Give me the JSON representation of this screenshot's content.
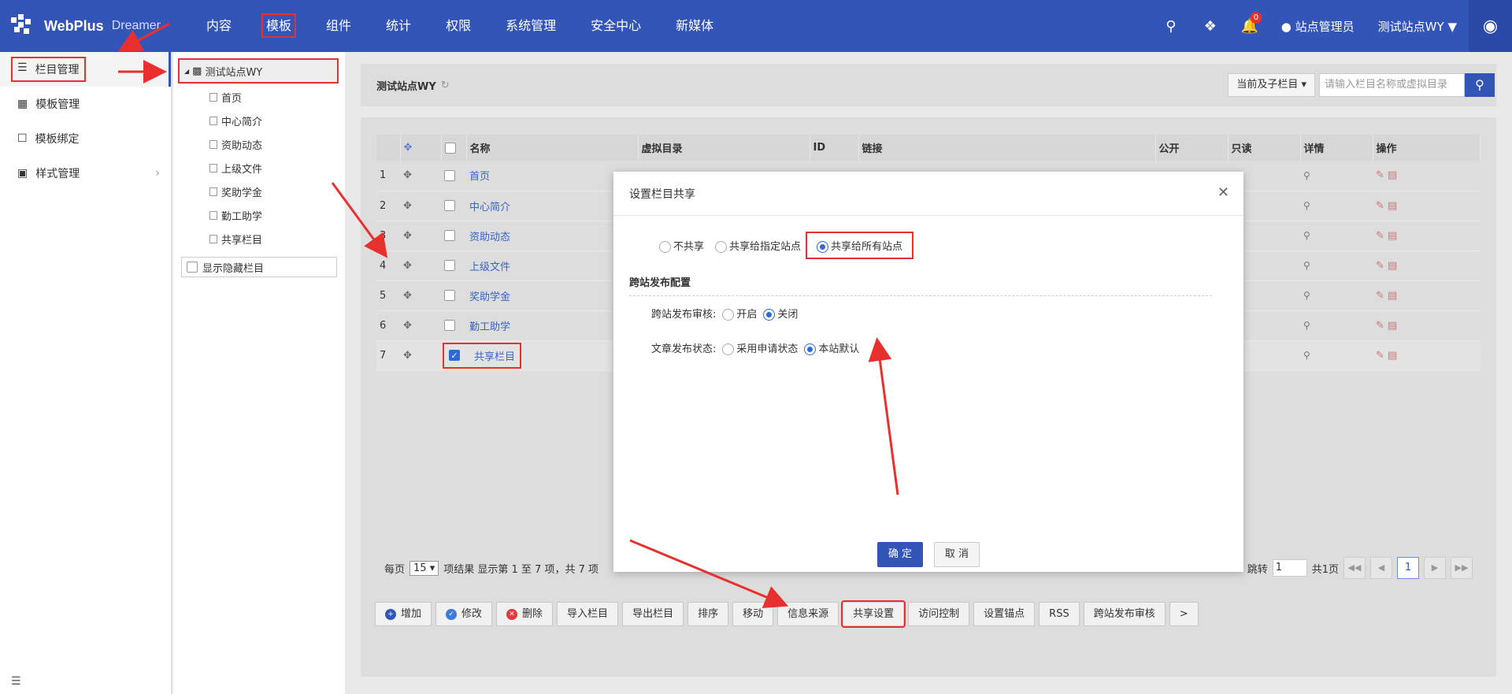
{
  "topbar": {
    "brand": "WebPlus",
    "brand_sub": "Dreamer",
    "nav": [
      "内容",
      "模板",
      "组件",
      "统计",
      "权限",
      "系统管理",
      "安全中心",
      "新媒体"
    ],
    "notify_count": "0",
    "user": "站点管理员",
    "site": "测试站点WY"
  },
  "sidebar": {
    "items": [
      {
        "label": "栏目管理",
        "icon": "column-icon"
      },
      {
        "label": "模板管理",
        "icon": "template-icon"
      },
      {
        "label": "模板绑定",
        "icon": "bind-icon"
      },
      {
        "label": "样式管理",
        "icon": "style-icon"
      }
    ]
  },
  "tree": {
    "root": "测试站点WY",
    "nodes": [
      "首页",
      "中心简介",
      "资助动态",
      "上级文件",
      "奖助学金",
      "勤工助学",
      "共享栏目"
    ],
    "show_hidden": "显示隐藏栏目"
  },
  "main": {
    "title": "测试站点WY",
    "scope_select": "当前及子栏目",
    "search_placeholder": "请输入栏目名称或虚拟目录",
    "columns": [
      "名称",
      "虚拟目录",
      "ID",
      "链接",
      "公开",
      "只读",
      "详情",
      "操作"
    ],
    "rows": [
      {
        "num": "1",
        "name": "首页"
      },
      {
        "num": "2",
        "name": "中心简介"
      },
      {
        "num": "3",
        "name": "资助动态"
      },
      {
        "num": "4",
        "name": "上级文件"
      },
      {
        "num": "5",
        "name": "奖助学金"
      },
      {
        "num": "6",
        "name": "勤工助学"
      },
      {
        "num": "7",
        "name": "共享栏目"
      }
    ],
    "pager": {
      "per_page_label": "每页",
      "per_page": "15",
      "summary": "项结果 显示第 1 至 7 项，共 7 项",
      "jump_label": "跳转",
      "jump_value": "1",
      "total_pages": "共1页",
      "current_page": "1"
    },
    "buttons": [
      "增加",
      "修改",
      "删除",
      "导入栏目",
      "导出栏目",
      "排序",
      "移动",
      "信息来源",
      "共享设置",
      "访问控制",
      "设置锚点",
      "RSS",
      "跨站发布审核",
      ">"
    ]
  },
  "modal": {
    "title": "设置栏目共享",
    "share_options": [
      "不共享",
      "共享给指定站点",
      "共享给所有站点"
    ],
    "selected_share": 2,
    "section_title": "跨站发布配置",
    "audit_label": "跨站发布审核:",
    "audit_options": [
      "开启",
      "关闭"
    ],
    "status_label": "文章发布状态:",
    "status_options": [
      "采用申请状态",
      "本站默认"
    ],
    "ok": "确 定",
    "cancel": "取 消"
  },
  "colors": {
    "accent": "#3355b7",
    "highlight": "#e8312f"
  }
}
